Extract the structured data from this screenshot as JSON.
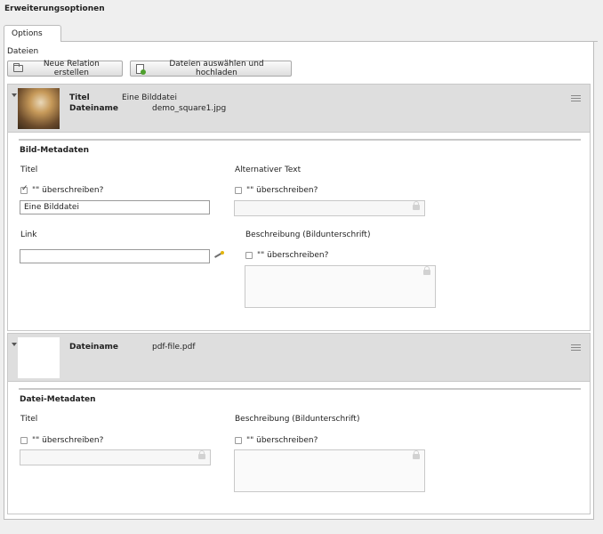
{
  "section_title": "Erweiterungsoptionen",
  "tabs": [
    {
      "label": "Options"
    }
  ],
  "dateien": {
    "label": "Dateien",
    "buttons": {
      "new_relation": "Neue Relation erstellen",
      "select_upload": "Dateien auswählen und hochladen"
    }
  },
  "records": [
    {
      "header": {
        "titel_label": "Titel",
        "titel_value": "Eine Bilddatei",
        "dateiname_label": "Dateiname",
        "dateiname_value": "demo_square1.jpg"
      },
      "metadata": {
        "title": "Bild-Metadaten",
        "fields": {
          "titel": {
            "label": "Titel",
            "override": "\"\" überschreiben?",
            "checked": true,
            "value": "Eine Bilddatei"
          },
          "alt": {
            "label": "Alternativer Text",
            "override": "\"\" überschreiben?",
            "checked": false,
            "value": ""
          },
          "link": {
            "label": "Link",
            "value": ""
          },
          "beschreibung": {
            "label": "Beschreibung (Bildunterschrift)",
            "override": "\"\" überschreiben?",
            "checked": false
          }
        }
      }
    },
    {
      "header": {
        "dateiname_label": "Dateiname",
        "dateiname_value": "pdf-file.pdf"
      },
      "metadata": {
        "title": "Datei-Metadaten",
        "fields": {
          "titel": {
            "label": "Titel",
            "override": "\"\" überschreiben?",
            "checked": false,
            "value": ""
          },
          "beschreibung": {
            "label": "Beschreibung (Bildunterschrift)",
            "override": "\"\" überschreiben?",
            "checked": false
          }
        }
      }
    }
  ],
  "icons": {
    "folder": "folder-icon",
    "upload": "file-upload-icon",
    "drag": "drag-handle-icon",
    "lock": "lock-icon",
    "link_wizard": "link-wizard-icon",
    "collapse": "caret-down-icon"
  }
}
